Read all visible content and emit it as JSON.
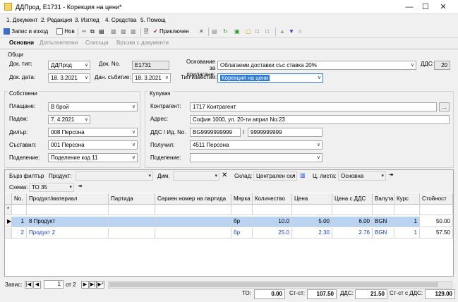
{
  "window": {
    "title": "ДДПрод, Е1731 - Корекция на цени*"
  },
  "menu": [
    "1. Документ",
    "2. Редакция",
    "3. Изглед",
    "4. Средства",
    "5. Помощ"
  ],
  "toolbar": {
    "save_exit": "Запис и изход",
    "new": "Нов",
    "finalized": "Приключен"
  },
  "tabs": [
    "Основни",
    "Допълнителни",
    "Списъци",
    "Връзки с документи"
  ],
  "general": {
    "title": "Общи",
    "doc_type_label": "Док. тип:",
    "doc_type": "ДДПрод",
    "doc_no_label": "Док. No.",
    "doc_no": "Е1731",
    "basis_label": "Основание за прилагане:",
    "basis": "Облагаеми доставки със ставка 20%",
    "vat_label": "ДДС:",
    "vat": "20",
    "doc_date_label": "Док. дата:",
    "doc_date": "18. 3.2021",
    "tax_event_label": "Дан. събитие:",
    "tax_event": "18. 3.2021",
    "notice_type_label": "Тип известие:",
    "notice_type": "Корекция на цени"
  },
  "own": {
    "title": "Собствени",
    "payment_label": "Плащане:",
    "payment": "В брой",
    "due_label": "Падеж:",
    "due": "7. 4.2021",
    "dealer_label": "Дилър:",
    "dealer": "008 Персона",
    "author_label": "Съставил:",
    "author": "001 Персона",
    "division_label": "Поделение:",
    "division": "Поделение код 11"
  },
  "buyer": {
    "title": "Купувач",
    "contractor_label": "Контрагент:",
    "contractor": "1717 Контрагент",
    "address_label": "Адрес:",
    "address": "София 1000, ул. 20-ти април No:23",
    "vatid_label": "ДДС / Ид. No.",
    "vat_no": "BG9999999999",
    "id_no": "9999999999",
    "recipient_label": "Получил:",
    "recipient": "4511 Персона",
    "division_label": "Поделение:",
    "division": ""
  },
  "filter": {
    "quick_label": "Бърз филтър",
    "product_label": "Продукт:",
    "dim_label": "Дим.",
    "warehouse_label": "Склад:",
    "warehouse": "Централен скл",
    "pricelist_label": "Ц. листа:",
    "pricelist": "Основна",
    "schema_label": "Схема:",
    "schema": "ТО 35"
  },
  "grid": {
    "columns": [
      "No.",
      "Продукт/материал",
      "Партида",
      "Сериен номер на партида",
      "Мярка",
      "Количество",
      "Цена",
      "Цена с ДДС",
      "Валута",
      "Курс",
      "Стойност"
    ],
    "new_row_marker": "*",
    "rows": [
      [
        "1",
        "8 Продукт",
        "",
        "",
        "бр",
        "10.0",
        "5.00",
        "6.00",
        "BGN",
        "1",
        "50.00"
      ],
      [
        "2",
        "Продукт 2",
        "",
        "",
        "бр",
        "25.0",
        "2.30",
        "2.76",
        "BGN",
        "1",
        "57.50"
      ]
    ]
  },
  "status": {
    "record_label": "Запис:",
    "record_no": "1",
    "record_of": "от 2",
    "to_label": "ТО:",
    "to": "0.00",
    "net_label": "Ст-ст:",
    "net": "107.50",
    "vat_label": "ДДС:",
    "vat": "21.50",
    "gross_label": "Ст-ст с ДДС:",
    "gross": "129.00"
  },
  "colors": {
    "selected_row": "#b9d4f2",
    "link_blue": "#1a3fbf",
    "accent": "#3078d0"
  }
}
